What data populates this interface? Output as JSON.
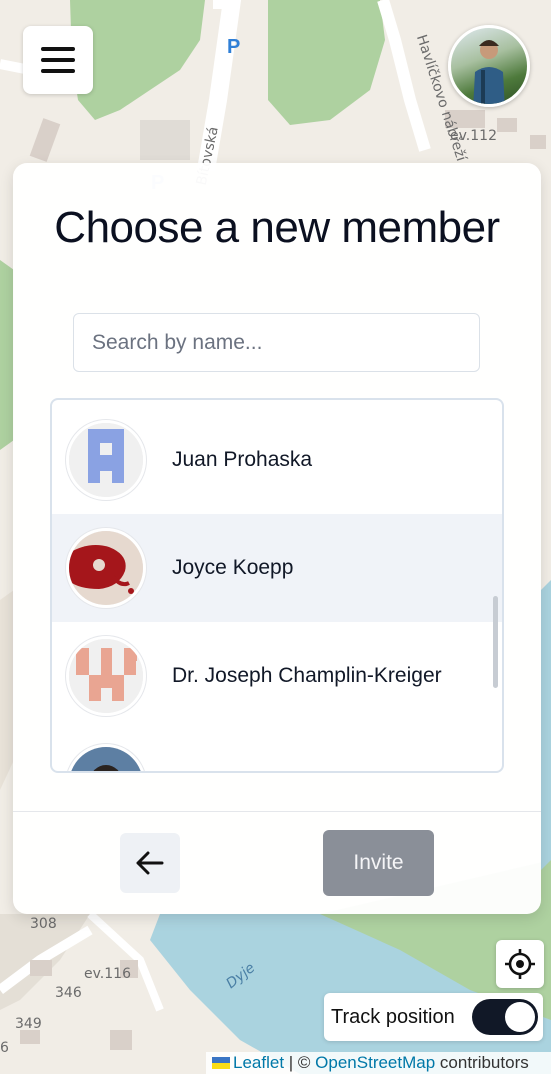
{
  "map": {
    "street_labels": [
      "Bítovská",
      "Havlíčkovo nábřeží",
      "Havlíčkovo nábřeží",
      "Dyje"
    ],
    "house_numbers": [
      "ev.112",
      "308",
      "ev.116",
      "346",
      "349",
      "6"
    ],
    "parking_symbol": "P"
  },
  "header": {
    "menu_icon": "hamburger-menu-icon",
    "user_avatar_icon": "user-photo"
  },
  "modal": {
    "title": "Choose a new member",
    "search": {
      "placeholder": "Search by name...",
      "value": ""
    },
    "members": [
      {
        "name": "Juan Prohaska",
        "avatar": "identicon-blue"
      },
      {
        "name": "Joyce Koepp",
        "avatar": "photo-red"
      },
      {
        "name": "Dr. Joseph Champlin-Kreiger",
        "avatar": "identicon-salmon"
      },
      {
        "name": "",
        "avatar": "photo-person"
      }
    ],
    "back_icon": "arrow-left-icon",
    "invite_label": "Invite"
  },
  "controls": {
    "locate_icon": "crosshair-icon",
    "track_label": "Track position",
    "track_enabled": true
  },
  "attribution": {
    "leaflet": "Leaflet",
    "separator": " | © ",
    "osm": "OpenStreetMap",
    "suffix": " contributors"
  },
  "colors": {
    "title": "#0b1020",
    "invite_disabled": "#8a8f98",
    "toggle_on": "#111827",
    "map_green": "#aed1a0",
    "river": "#aad3df",
    "link": "#0078a8"
  }
}
